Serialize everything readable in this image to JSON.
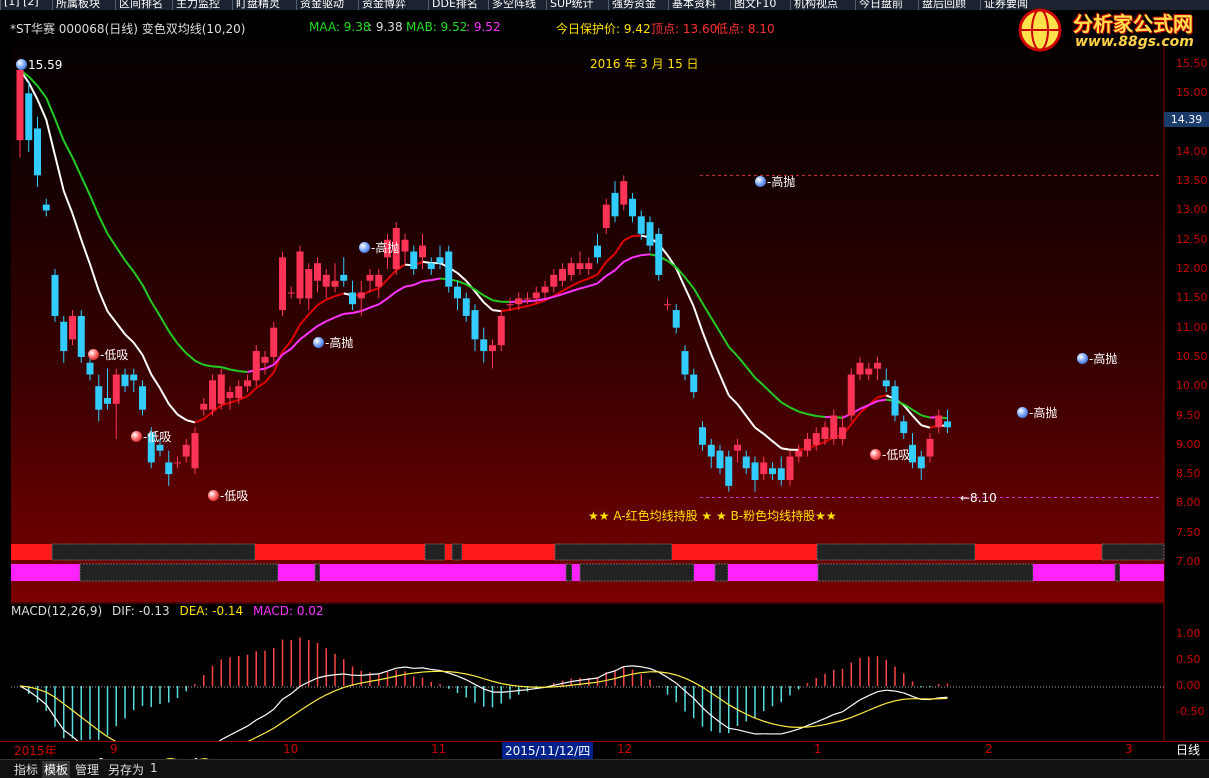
{
  "top_tabs": [
    "[1] [2]",
    "所属板块",
    "区间排名",
    "主力监控",
    "盯盘精灵",
    "资金驱动",
    "资金博弈",
    "DDE排名",
    "多空阵线",
    "SUP统计",
    "强势资金",
    "基本资料",
    "图文F10",
    "机构视点",
    "今日盘前",
    "盘后回顾",
    "证券要闻"
  ],
  "info": {
    "stock": "*ST华赛 000068(日线) 变色双均线(10,20)",
    "maa_label": "MAA: 9.38",
    "maa_value": ": 9.38",
    "mab_label": "MAB: 9.52",
    "mab_value": ": 9.52",
    "protect": "今日保护价: 9.42",
    "top": "顶点: 13.60",
    "low": "低点: 8.10"
  },
  "logo": {
    "title": "分析家公式网",
    "url": "www.88gs.com"
  },
  "chart_date": "2016 年 3 月 15 日",
  "current_price": "14.39",
  "price_ticks": [
    "15.50",
    "15.00",
    "14.00",
    "13.50",
    "13.00",
    "12.50",
    "12.00",
    "11.50",
    "11.00",
    "10.50",
    "10.00",
    "9.50",
    "9.00",
    "8.50",
    "8.00",
    "7.50",
    "7.00"
  ],
  "macd_ticks": [
    "1.00",
    "0.50",
    "0.00",
    "-0.50"
  ],
  "annotations": {
    "high_sell": "-高抛",
    "low_buy": "-低吸",
    "max_label": "15.59",
    "min_label": "8.10"
  },
  "legend_text": "★★ A-红色均线持股 ★  ★ B-粉色均线持股★★",
  "macd": {
    "title": "MACD(12,26,9)",
    "dif": "DIF: -0.13",
    "dea": "DEA: -0.14",
    "macd": "MACD: 0.02"
  },
  "x_axis": {
    "labels": [
      "2015年",
      "9",
      "10",
      "11",
      "12",
      "1",
      "2",
      "3"
    ],
    "selected": "2015/11/12/四",
    "period": "日线"
  },
  "bottom_tabs": [
    "指标",
    "模板",
    "管理",
    "另存为",
    "1"
  ],
  "colors": {
    "up": "#ff3355",
    "down": "#33ccff",
    "ma_red": "#e00000",
    "ma_pink": "#ff33ff",
    "ma_green": "#22cc22",
    "ma_white": "#ffffff"
  },
  "chart_data": {
    "type": "candlestick",
    "y_range": [
      7.0,
      15.6
    ],
    "candles": [
      {
        "o": 14.2,
        "h": 15.59,
        "l": 13.9,
        "c": 15.4
      },
      {
        "o": 15.0,
        "h": 15.2,
        "l": 14.0,
        "c": 14.2
      },
      {
        "o": 14.4,
        "h": 14.6,
        "l": 13.4,
        "c": 13.6
      },
      {
        "o": 13.1,
        "h": 13.2,
        "l": 12.9,
        "c": 13.0
      },
      {
        "o": 11.9,
        "h": 12.0,
        "l": 11.1,
        "c": 11.2
      },
      {
        "o": 11.1,
        "h": 11.2,
        "l": 10.4,
        "c": 10.6
      },
      {
        "o": 10.8,
        "h": 11.3,
        "l": 10.7,
        "c": 11.2
      },
      {
        "o": 11.2,
        "h": 11.3,
        "l": 10.4,
        "c": 10.5
      },
      {
        "o": 10.4,
        "h": 10.5,
        "l": 10.1,
        "c": 10.2
      },
      {
        "o": 10.0,
        "h": 10.2,
        "l": 9.4,
        "c": 9.6
      },
      {
        "o": 9.8,
        "h": 10.3,
        "l": 9.6,
        "c": 9.7
      },
      {
        "o": 9.7,
        "h": 10.3,
        "l": 9.1,
        "c": 10.2
      },
      {
        "o": 10.2,
        "h": 10.3,
        "l": 9.9,
        "c": 10.0
      },
      {
        "o": 10.2,
        "h": 10.3,
        "l": 9.9,
        "c": 10.1
      },
      {
        "o": 10.0,
        "h": 10.1,
        "l": 9.5,
        "c": 9.6
      },
      {
        "o": 9.2,
        "h": 9.3,
        "l": 8.6,
        "c": 8.7
      },
      {
        "o": 9.0,
        "h": 9.1,
        "l": 8.8,
        "c": 8.9
      },
      {
        "o": 8.7,
        "h": 8.9,
        "l": 8.3,
        "c": 8.5
      },
      {
        "o": 8.7,
        "h": 8.8,
        "l": 8.6,
        "c": 8.7
      },
      {
        "o": 8.8,
        "h": 9.1,
        "l": 8.7,
        "c": 9.0
      },
      {
        "o": 8.6,
        "h": 9.3,
        "l": 8.5,
        "c": 9.2
      },
      {
        "o": 9.6,
        "h": 9.8,
        "l": 9.5,
        "c": 9.7
      },
      {
        "o": 9.6,
        "h": 10.2,
        "l": 9.5,
        "c": 10.1
      },
      {
        "o": 9.7,
        "h": 10.3,
        "l": 9.6,
        "c": 10.2
      },
      {
        "o": 9.8,
        "h": 10.0,
        "l": 9.6,
        "c": 9.9
      },
      {
        "o": 9.8,
        "h": 10.1,
        "l": 9.7,
        "c": 10.0
      },
      {
        "o": 10.0,
        "h": 10.2,
        "l": 9.9,
        "c": 10.1
      },
      {
        "o": 10.1,
        "h": 10.7,
        "l": 10.0,
        "c": 10.6
      },
      {
        "o": 10.4,
        "h": 10.6,
        "l": 10.2,
        "c": 10.5
      },
      {
        "o": 10.5,
        "h": 11.1,
        "l": 10.4,
        "c": 11.0
      },
      {
        "o": 11.3,
        "h": 12.3,
        "l": 11.2,
        "c": 12.2
      },
      {
        "o": 11.6,
        "h": 11.7,
        "l": 11.5,
        "c": 11.6
      },
      {
        "o": 11.5,
        "h": 12.4,
        "l": 11.4,
        "c": 12.3
      },
      {
        "o": 11.5,
        "h": 12.1,
        "l": 11.3,
        "c": 12.0
      },
      {
        "o": 11.8,
        "h": 12.2,
        "l": 11.6,
        "c": 12.1
      },
      {
        "o": 11.7,
        "h": 12.0,
        "l": 11.5,
        "c": 11.9
      },
      {
        "o": 11.7,
        "h": 12.1,
        "l": 11.6,
        "c": 11.8
      },
      {
        "o": 11.9,
        "h": 12.2,
        "l": 11.7,
        "c": 11.8
      },
      {
        "o": 11.6,
        "h": 11.8,
        "l": 11.3,
        "c": 11.4
      },
      {
        "o": 11.5,
        "h": 11.8,
        "l": 11.2,
        "c": 11.6
      },
      {
        "o": 11.8,
        "h": 12.0,
        "l": 11.6,
        "c": 11.9
      },
      {
        "o": 11.7,
        "h": 12.0,
        "l": 11.5,
        "c": 11.9
      },
      {
        "o": 12.2,
        "h": 12.6,
        "l": 12.0,
        "c": 12.5
      },
      {
        "o": 12.0,
        "h": 12.8,
        "l": 11.9,
        "c": 12.7
      },
      {
        "o": 12.3,
        "h": 12.6,
        "l": 12.1,
        "c": 12.5
      },
      {
        "o": 12.3,
        "h": 12.4,
        "l": 11.9,
        "c": 12.0
      },
      {
        "o": 12.2,
        "h": 12.6,
        "l": 12.0,
        "c": 12.4
      },
      {
        "o": 12.1,
        "h": 12.2,
        "l": 11.9,
        "c": 12.0
      },
      {
        "o": 12.2,
        "h": 12.4,
        "l": 12.0,
        "c": 12.1
      },
      {
        "o": 12.3,
        "h": 12.4,
        "l": 11.6,
        "c": 11.7
      },
      {
        "o": 11.7,
        "h": 11.8,
        "l": 11.3,
        "c": 11.5
      },
      {
        "o": 11.5,
        "h": 11.6,
        "l": 11.1,
        "c": 11.2
      },
      {
        "o": 11.3,
        "h": 11.4,
        "l": 10.6,
        "c": 10.8
      },
      {
        "o": 10.8,
        "h": 11.0,
        "l": 10.4,
        "c": 10.6
      },
      {
        "o": 10.6,
        "h": 10.8,
        "l": 10.3,
        "c": 10.7
      },
      {
        "o": 10.7,
        "h": 11.3,
        "l": 10.6,
        "c": 11.2
      },
      {
        "o": 11.4,
        "h": 11.5,
        "l": 11.3,
        "c": 11.4
      },
      {
        "o": 11.4,
        "h": 11.6,
        "l": 11.3,
        "c": 11.5
      },
      {
        "o": 11.5,
        "h": 11.6,
        "l": 11.4,
        "c": 11.5
      },
      {
        "o": 11.5,
        "h": 11.7,
        "l": 11.4,
        "c": 11.6
      },
      {
        "o": 11.6,
        "h": 11.8,
        "l": 11.5,
        "c": 11.7
      },
      {
        "o": 11.7,
        "h": 12.0,
        "l": 11.6,
        "c": 11.9
      },
      {
        "o": 11.8,
        "h": 12.1,
        "l": 11.7,
        "c": 12.0
      },
      {
        "o": 11.9,
        "h": 12.2,
        "l": 11.8,
        "c": 12.1
      },
      {
        "o": 12.0,
        "h": 12.3,
        "l": 11.9,
        "c": 12.1
      },
      {
        "o": 12.0,
        "h": 12.2,
        "l": 11.9,
        "c": 12.1
      },
      {
        "o": 12.4,
        "h": 12.6,
        "l": 12.1,
        "c": 12.2
      },
      {
        "o": 12.7,
        "h": 13.2,
        "l": 12.6,
        "c": 13.1
      },
      {
        "o": 13.3,
        "h": 13.5,
        "l": 12.8,
        "c": 12.9
      },
      {
        "o": 13.1,
        "h": 13.6,
        "l": 13.0,
        "c": 13.5
      },
      {
        "o": 13.2,
        "h": 13.3,
        "l": 12.8,
        "c": 12.9
      },
      {
        "o": 12.9,
        "h": 13.0,
        "l": 12.5,
        "c": 12.6
      },
      {
        "o": 12.8,
        "h": 12.9,
        "l": 12.3,
        "c": 12.4
      },
      {
        "o": 12.6,
        "h": 12.7,
        "l": 11.8,
        "c": 11.9
      },
      {
        "o": 11.4,
        "h": 11.5,
        "l": 11.3,
        "c": 11.4
      },
      {
        "o": 11.3,
        "h": 11.4,
        "l": 10.9,
        "c": 11.0
      },
      {
        "o": 10.6,
        "h": 10.7,
        "l": 10.1,
        "c": 10.2
      },
      {
        "o": 10.2,
        "h": 10.3,
        "l": 9.8,
        "c": 9.9
      },
      {
        "o": 9.3,
        "h": 9.4,
        "l": 8.9,
        "c": 9.0
      },
      {
        "o": 9.0,
        "h": 9.1,
        "l": 8.6,
        "c": 8.8
      },
      {
        "o": 8.9,
        "h": 9.0,
        "l": 8.5,
        "c": 8.6
      },
      {
        "o": 8.8,
        "h": 8.9,
        "l": 8.2,
        "c": 8.3
      },
      {
        "o": 8.9,
        "h": 9.1,
        "l": 8.7,
        "c": 9.0
      },
      {
        "o": 8.8,
        "h": 8.9,
        "l": 8.5,
        "c": 8.6
      },
      {
        "o": 8.7,
        "h": 8.8,
        "l": 8.2,
        "c": 8.4
      },
      {
        "o": 8.5,
        "h": 8.8,
        "l": 8.4,
        "c": 8.7
      },
      {
        "o": 8.6,
        "h": 8.7,
        "l": 8.4,
        "c": 8.5
      },
      {
        "o": 8.6,
        "h": 8.8,
        "l": 8.3,
        "c": 8.4
      },
      {
        "o": 8.4,
        "h": 8.9,
        "l": 8.3,
        "c": 8.8
      },
      {
        "o": 8.8,
        "h": 9.0,
        "l": 8.7,
        "c": 8.9
      },
      {
        "o": 8.9,
        "h": 9.2,
        "l": 8.8,
        "c": 9.1
      },
      {
        "o": 9.0,
        "h": 9.3,
        "l": 8.9,
        "c": 9.2
      },
      {
        "o": 9.1,
        "h": 9.4,
        "l": 9.0,
        "c": 9.3
      },
      {
        "o": 9.1,
        "h": 9.6,
        "l": 9.0,
        "c": 9.5
      },
      {
        "o": 9.1,
        "h": 9.5,
        "l": 9.0,
        "c": 9.3
      },
      {
        "o": 9.5,
        "h": 10.3,
        "l": 9.4,
        "c": 10.2
      },
      {
        "o": 10.2,
        "h": 10.5,
        "l": 10.1,
        "c": 10.4
      },
      {
        "o": 10.2,
        "h": 10.4,
        "l": 10.1,
        "c": 10.3
      },
      {
        "o": 10.3,
        "h": 10.5,
        "l": 10.1,
        "c": 10.4
      },
      {
        "o": 10.1,
        "h": 10.3,
        "l": 9.9,
        "c": 10.0
      },
      {
        "o": 10.0,
        "h": 10.1,
        "l": 9.4,
        "c": 9.5
      },
      {
        "o": 9.4,
        "h": 9.5,
        "l": 9.1,
        "c": 9.2
      },
      {
        "o": 9.0,
        "h": 9.2,
        "l": 8.6,
        "c": 8.7
      },
      {
        "o": 8.8,
        "h": 8.9,
        "l": 8.4,
        "c": 8.6
      },
      {
        "o": 8.8,
        "h": 9.2,
        "l": 8.7,
        "c": 9.1
      },
      {
        "o": 9.3,
        "h": 9.6,
        "l": 9.2,
        "c": 9.5
      },
      {
        "o": 9.4,
        "h": 9.6,
        "l": 9.2,
        "c": 9.3
      }
    ]
  }
}
